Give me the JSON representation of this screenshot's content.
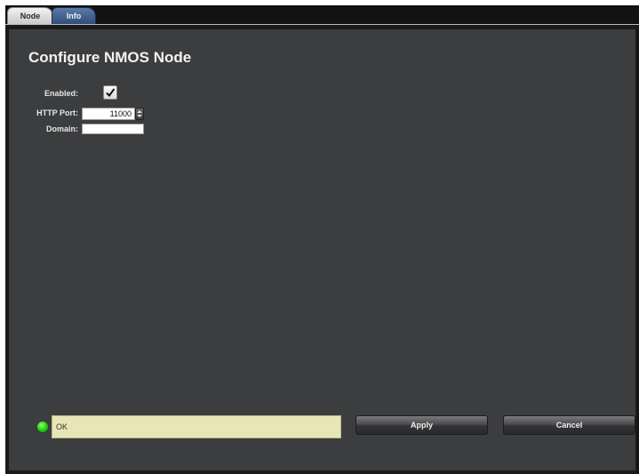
{
  "tabs": [
    {
      "label": "Node",
      "active": true
    },
    {
      "label": "Info",
      "active": false
    }
  ],
  "page": {
    "title": "Configure NMOS Node"
  },
  "form": {
    "enabled_label": "Enabled:",
    "enabled_checked": true,
    "http_port_label": "HTTP Port:",
    "http_port_value": "11000",
    "domain_label": "Domain:",
    "domain_value": ""
  },
  "status": {
    "text": "OK",
    "color": "#17c80b"
  },
  "actions": {
    "apply_label": "Apply",
    "cancel_label": "Cancel"
  },
  "colors": {
    "panel_bg": "#3c3d3f",
    "status_bg": "#e8e6b6"
  }
}
